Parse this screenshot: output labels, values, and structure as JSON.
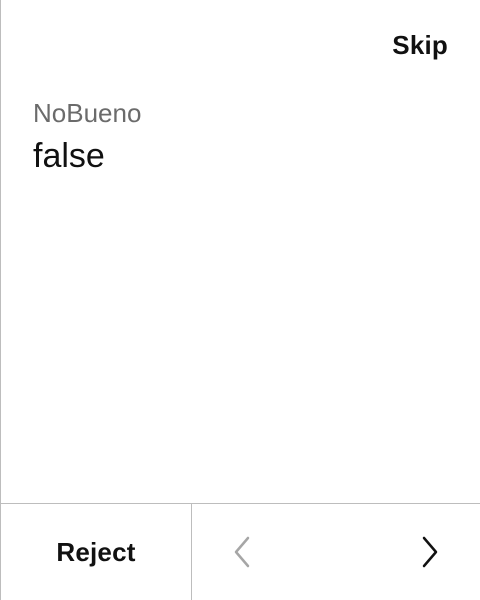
{
  "header": {
    "skip_label": "Skip"
  },
  "field": {
    "label": "NoBueno",
    "value": "false"
  },
  "footer": {
    "reject_label": "Reject",
    "prev_icon": "chevron-left-icon",
    "next_icon": "chevron-right-icon"
  },
  "colors": {
    "text_primary": "#111111",
    "text_secondary": "#6b6b6b",
    "divider": "#bdbdbd",
    "disabled_icon": "#a6a6a6"
  }
}
